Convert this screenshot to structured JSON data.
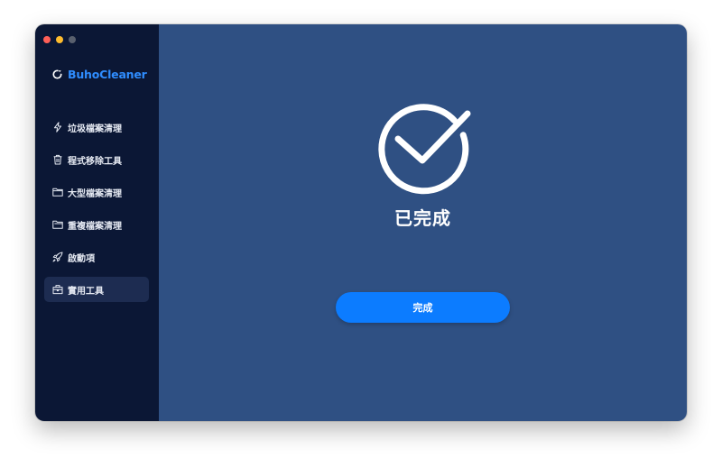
{
  "window": {
    "controls": [
      "close",
      "minimize",
      "zoom"
    ]
  },
  "sidebar": {
    "brand": {
      "icon": "buhocleaner-logo-icon",
      "name": "BuhoCleaner"
    },
    "items": [
      {
        "label": "垃圾檔案清理",
        "icon": "bolt-icon",
        "active": false
      },
      {
        "label": "程式移除工具",
        "icon": "trash-icon",
        "active": false
      },
      {
        "label": "大型檔案清理",
        "icon": "folder-icon",
        "active": false
      },
      {
        "label": "重複檔案清理",
        "icon": "duplicate-folder-icon",
        "active": false
      },
      {
        "label": "啟動項",
        "icon": "rocket-icon",
        "active": false
      },
      {
        "label": "實用工具",
        "icon": "toolbox-icon",
        "active": true
      }
    ]
  },
  "main": {
    "status_icon": "checkmark-circle-icon",
    "title": "已完成",
    "button_label": "完成"
  },
  "colors": {
    "sidebar_bg": "#0b1735",
    "sidebar_active_bg": "#1d2c51",
    "main_bg": "#2f5083",
    "brand": "#2f8dff",
    "button": "#0c7cff",
    "text": "#ffffff"
  }
}
